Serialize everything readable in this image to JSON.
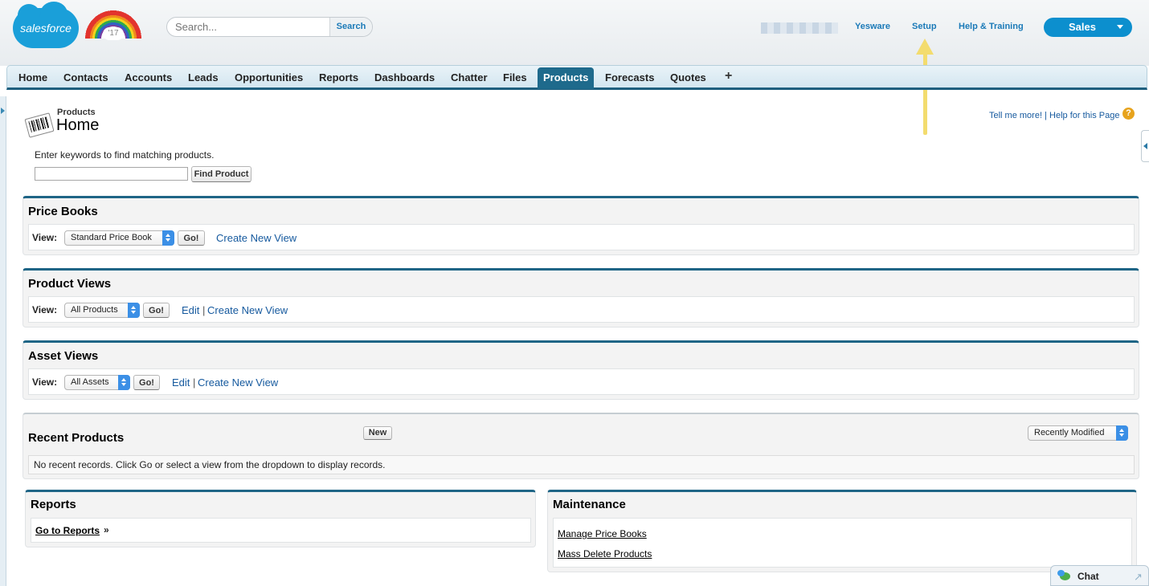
{
  "brand": {
    "logo_text": "salesforce",
    "badge_text": "'17"
  },
  "search": {
    "placeholder": "Search...",
    "button_label": "Search"
  },
  "header_links": {
    "yesware": "Yesware",
    "setup": "Setup",
    "help_training": "Help & Training"
  },
  "app_menu": {
    "label": "Sales"
  },
  "tabs": [
    {
      "label": "Home"
    },
    {
      "label": "Contacts"
    },
    {
      "label": "Accounts"
    },
    {
      "label": "Leads"
    },
    {
      "label": "Opportunities"
    },
    {
      "label": "Reports"
    },
    {
      "label": "Dashboards"
    },
    {
      "label": "Chatter"
    },
    {
      "label": "Files"
    },
    {
      "label": "Products"
    },
    {
      "label": "Forecasts"
    },
    {
      "label": "Quotes"
    }
  ],
  "active_tab": "Products",
  "tab_add_symbol": "+",
  "page": {
    "breadcrumb": "Products",
    "title": "Home",
    "tell_me_more": "Tell me more!",
    "help_sep": "|",
    "help_for_page": "Help for this Page",
    "help_icon_glyph": "?",
    "keyword_prompt": "Enter keywords to find matching products.",
    "find_button": "Find Product"
  },
  "price_books": {
    "title": "Price Books",
    "view_label": "View:",
    "selected": "Standard Price Book",
    "go_label": "Go!",
    "create_link": "Create New View"
  },
  "product_views": {
    "title": "Product Views",
    "view_label": "View:",
    "selected": "All Products",
    "go_label": "Go!",
    "edit_link": "Edit",
    "sep": "|",
    "create_link": "Create New View"
  },
  "asset_views": {
    "title": "Asset Views",
    "view_label": "View:",
    "selected": "All Assets",
    "go_label": "Go!",
    "edit_link": "Edit",
    "sep": "|",
    "create_link": "Create New View"
  },
  "recent_products": {
    "title": "Recent Products",
    "new_label": "New",
    "sort_selected": "Recently Modified",
    "empty_message": "No recent records. Click Go or select a view from the dropdown to display records."
  },
  "reports": {
    "title": "Reports",
    "link": "Go to Reports",
    "link_suffix": "»"
  },
  "maintenance": {
    "title": "Maintenance",
    "links": [
      "Manage Price Books",
      "Mass Delete Products"
    ]
  },
  "chat": {
    "label": "Chat"
  },
  "colors": {
    "brand_blue": "#1a9fd9",
    "tab_active": "#1e6a8c",
    "link_blue": "#15599e",
    "annotation_arrow": "#f3dc6e"
  }
}
